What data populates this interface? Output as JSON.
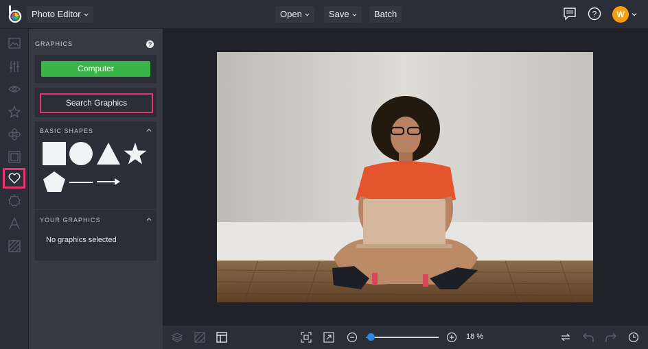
{
  "header": {
    "app_menu_label": "Photo Editor",
    "open_label": "Open",
    "save_label": "Save",
    "batch_label": "Batch",
    "avatar_initial": "W"
  },
  "rail": {
    "items": [
      "edit-icon",
      "adjust-icon",
      "eye-icon",
      "star-icon",
      "touch-up-icon",
      "frame-icon",
      "heart-icon",
      "badge-icon",
      "text-icon",
      "texture-icon"
    ],
    "active": "heart-icon"
  },
  "panel": {
    "title": "GRAPHICS",
    "computer_label": "Computer",
    "search_label": "Search Graphics",
    "basic_shapes_title": "BASIC SHAPES",
    "shapes": [
      "square",
      "circle",
      "triangle",
      "star",
      "pentagon",
      "line",
      "arrow"
    ],
    "your_graphics_title": "YOUR GRAPHICS",
    "no_graphics": "No graphics selected"
  },
  "bottom": {
    "zoom_label": "18 %",
    "zoom_fraction": 0.07
  },
  "colors": {
    "accent_pink": "#e8356f",
    "computer_green": "#3bb54a",
    "avatar_orange": "#f59f0b",
    "zoom_blue": "#2e86de"
  }
}
